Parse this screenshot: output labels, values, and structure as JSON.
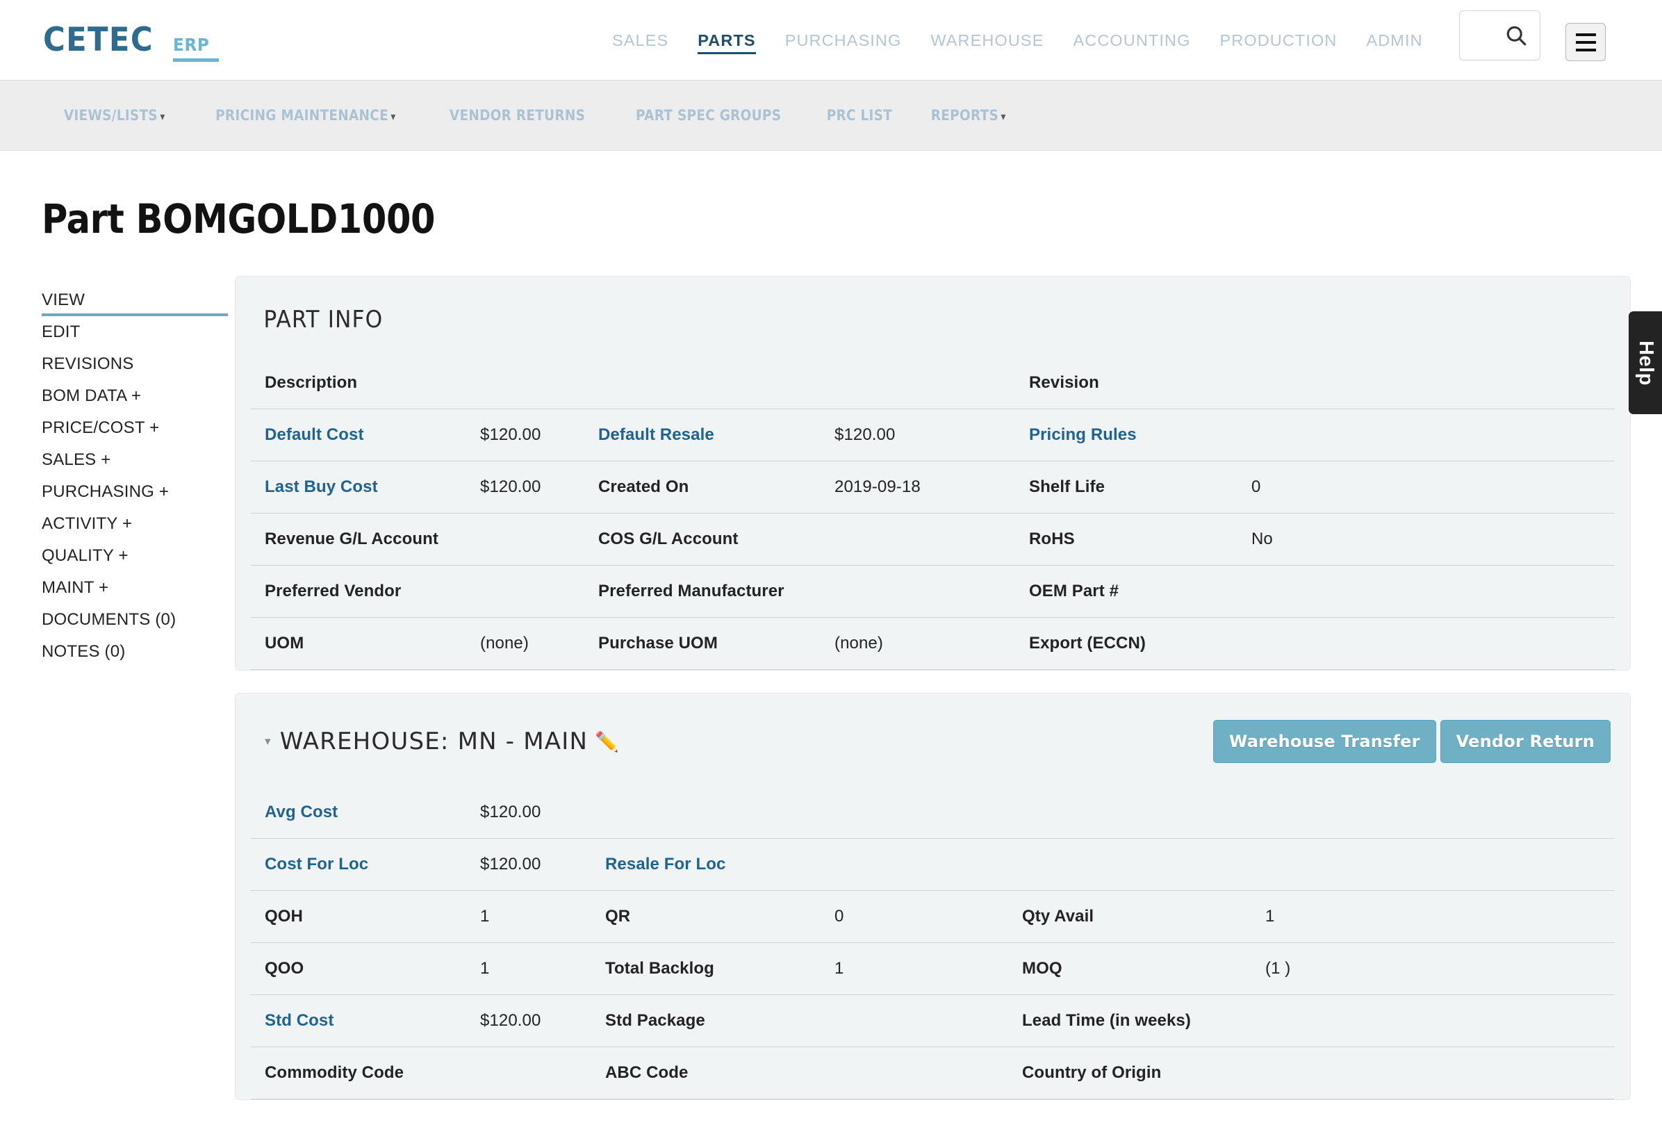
{
  "brand": {
    "name": "CETEC",
    "suffix": "ERP"
  },
  "top_nav": {
    "items": [
      {
        "label": "SALES",
        "active": false
      },
      {
        "label": "PARTS",
        "active": true
      },
      {
        "label": "PURCHASING",
        "active": false
      },
      {
        "label": "WAREHOUSE",
        "active": false
      },
      {
        "label": "ACCOUNTING",
        "active": false
      },
      {
        "label": "PRODUCTION",
        "active": false
      },
      {
        "label": "ADMIN",
        "active": false
      }
    ],
    "search_placeholder": "",
    "search_value": "",
    "search_icon": "search-icon",
    "menu_icon": "hamburger-icon"
  },
  "sub_nav": {
    "items": [
      {
        "label": "VIEWS/LISTS",
        "caret": "▾"
      },
      {
        "label": "PRICING MAINTENANCE",
        "caret": "▾"
      },
      {
        "label": "VENDOR RETURNS",
        "caret": ""
      },
      {
        "label": "PART SPEC GROUPS",
        "caret": ""
      },
      {
        "label": "PRC LIST",
        "caret": ""
      },
      {
        "label": "REPORTS",
        "caret": "▾"
      }
    ]
  },
  "page": {
    "title": "Part BOMGOLD1000"
  },
  "sidebar": {
    "items": [
      {
        "label": "VIEW",
        "active": true
      },
      {
        "label": "EDIT",
        "active": false
      },
      {
        "label": "REVISIONS",
        "active": false
      },
      {
        "label": "BOM DATA +",
        "active": false
      },
      {
        "label": "PRICE/COST +",
        "active": false
      },
      {
        "label": "SALES +",
        "active": false
      },
      {
        "label": "PURCHASING +",
        "active": false
      },
      {
        "label": "ACTIVITY +",
        "active": false
      },
      {
        "label": "QUALITY +",
        "active": false
      },
      {
        "label": "MAINT +",
        "active": false
      },
      {
        "label": "DOCUMENTS (0)",
        "active": false
      },
      {
        "label": "NOTES (0)",
        "active": false
      }
    ]
  },
  "part_info": {
    "title": "PART INFO",
    "header_row": {
      "c1": "Description",
      "c2": "",
      "c3": "",
      "c4": "",
      "c5": "Revision",
      "c6": ""
    },
    "rows": [
      {
        "l1": "Default Cost",
        "l1_link": true,
        "v1": "$120.00",
        "l2": "Default Resale",
        "l2_link": true,
        "v2": "$120.00",
        "l3": "Pricing Rules",
        "l3_link": true,
        "v3": ""
      },
      {
        "l1": "Last Buy Cost",
        "l1_link": true,
        "v1": "$120.00",
        "l2": "Created On",
        "l2_link": false,
        "v2": "2019-09-18",
        "l3": "Shelf Life",
        "l3_link": false,
        "v3": "0"
      },
      {
        "l1": "Revenue G/L Account",
        "l1_link": false,
        "v1": "",
        "l2": "COS G/L Account",
        "l2_link": false,
        "v2": "",
        "l3": "RoHS",
        "l3_link": false,
        "v3": "No"
      },
      {
        "l1": "Preferred Vendor",
        "l1_link": false,
        "v1": "",
        "l2": "Preferred Manufacturer",
        "l2_link": false,
        "v2": "",
        "l3": "OEM Part #",
        "l3_link": false,
        "v3": ""
      },
      {
        "l1": "UOM",
        "l1_link": false,
        "v1": "(none)",
        "l2": "Purchase UOM",
        "l2_link": false,
        "v2": "(none)",
        "l3": "Export (ECCN)",
        "l3_link": false,
        "v3": ""
      }
    ]
  },
  "warehouse": {
    "caret": "▾",
    "title": "WAREHOUSE: MN - MAIN",
    "pencil_icon": "✏️",
    "buttons": [
      {
        "label": "Warehouse Transfer"
      },
      {
        "label": "Vendor Return"
      }
    ],
    "rows": [
      {
        "l1": "Avg Cost",
        "l1_link": true,
        "v1": "$120.00",
        "l2": "",
        "l2_link": false,
        "v2": "",
        "l3": "",
        "l3_link": false,
        "v3": ""
      },
      {
        "l1": "Cost For Loc",
        "l1_link": true,
        "v1": "$120.00",
        "l2": "Resale For Loc",
        "l2_link": true,
        "v2": "",
        "l3": "",
        "l3_link": false,
        "v3": ""
      },
      {
        "l1": "QOH",
        "l1_link": false,
        "v1": "1",
        "l2": "QR",
        "l2_link": false,
        "v2": "0",
        "l3": "Qty Avail",
        "l3_link": false,
        "v3": "1"
      },
      {
        "l1": "QOO",
        "l1_link": false,
        "v1": "1",
        "l2": "Total Backlog",
        "l2_link": false,
        "v2": "1",
        "l3": "MOQ",
        "l3_link": false,
        "v3": "(1 )"
      },
      {
        "l1": "Std Cost",
        "l1_link": true,
        "v1": "$120.00",
        "l2": "Std Package",
        "l2_link": false,
        "v2": "",
        "l3": "Lead Time (in weeks)",
        "l3_link": false,
        "v3": ""
      },
      {
        "l1": "Commodity Code",
        "l1_link": false,
        "v1": "",
        "l2": "ABC Code",
        "l2_link": false,
        "v2": "",
        "l3": "Country of Origin",
        "l3_link": false,
        "v3": ""
      }
    ]
  },
  "help_tab": {
    "label": "Help"
  },
  "colors": {
    "brand_dark": "#2d6b8f",
    "brand_light": "#6cb4d4",
    "nav_inactive": "#b3c6d6",
    "nav_active": "#1f4e6b",
    "link": "#1f6391",
    "panel_bg": "#f0f4f5",
    "button_teal": "#6fb0c4",
    "accent_underline": "#6fa8bc"
  }
}
